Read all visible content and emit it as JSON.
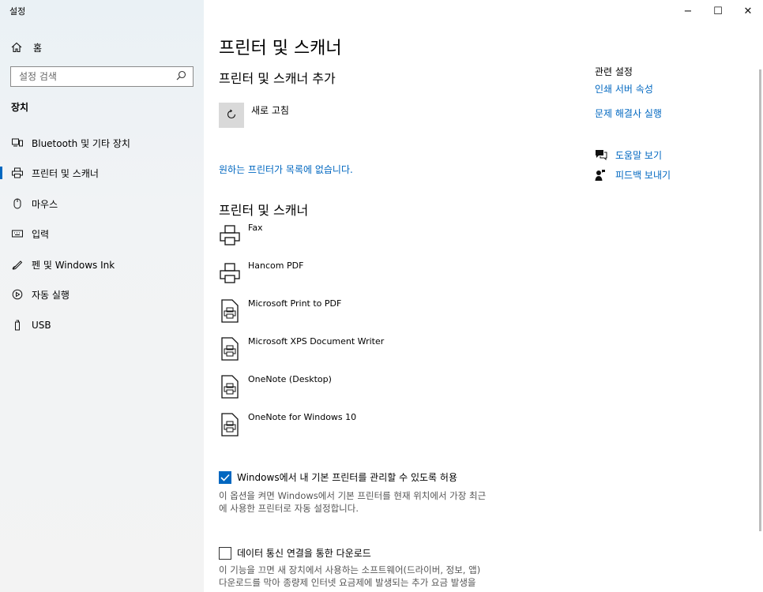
{
  "app": {
    "title": "설정"
  },
  "window_controls": {
    "minimize": "−",
    "maximize": "☐",
    "close": "✕"
  },
  "sidebar": {
    "home_label": "홈",
    "search_placeholder": "설정 검색",
    "section_label": "장치",
    "items": [
      {
        "label": "Bluetooth 및 기타 장치",
        "icon": "bluetooth-devices-icon",
        "active": false
      },
      {
        "label": "프린터 및 스캐너",
        "icon": "printer-icon",
        "active": true
      },
      {
        "label": "마우스",
        "icon": "mouse-icon",
        "active": false
      },
      {
        "label": "입력",
        "icon": "keyboard-icon",
        "active": false
      },
      {
        "label": "펜 및 Windows Ink",
        "icon": "pen-icon",
        "active": false
      },
      {
        "label": "자동 실행",
        "icon": "autoplay-icon",
        "active": false
      },
      {
        "label": "USB",
        "icon": "usb-icon",
        "active": false
      }
    ]
  },
  "main": {
    "page_title": "프린터 및 스캐너",
    "add_section_title": "프린터 및 스캐너 추가",
    "refresh_label": "새로 고침",
    "not_listed_link": "원하는 프린터가 목록에 없습니다.",
    "printers_title": "프린터 및 스캐너",
    "printers": [
      {
        "name": "Fax",
        "icon": "printer-device-icon"
      },
      {
        "name": "Hancom PDF",
        "icon": "printer-device-icon"
      },
      {
        "name": "Microsoft Print to PDF",
        "icon": "document-printer-icon"
      },
      {
        "name": "Microsoft XPS Document Writer",
        "icon": "document-printer-icon"
      },
      {
        "name": "OneNote (Desktop)",
        "icon": "document-printer-icon"
      },
      {
        "name": "OneNote for Windows 10",
        "icon": "document-printer-icon"
      }
    ],
    "default_printer_checkbox": {
      "label": "Windows에서 내 기본 프린터를 관리할 수 있도록 허용",
      "checked": true,
      "description_line1": "이 옵션을 켜면 Windows에서 기본 프린터를 현재 위치에서 가장 최근",
      "description_line2": "에 사용한 프린터로 자동 설정합니다."
    },
    "metered_checkbox": {
      "label": "데이터 통신 연결을 통한 다운로드",
      "checked": false,
      "description_line1": "이 기능을 끄면 새 장치에서 사용하는 소프트웨어(드라이버, 정보, 앱)",
      "description_line2": "다운로드를 막아 종량제 인터넷 요금제에 발생되는 추가 요금 발생을"
    }
  },
  "related": {
    "title": "관련 설정",
    "links": [
      "인쇄 서버 속성",
      "문제 해결사 실행"
    ],
    "help_label": "도움말 보기",
    "feedback_label": "피드백 보내기"
  },
  "colors": {
    "accent": "#0067c0",
    "sidebar_bg": "#f1f3f5"
  }
}
